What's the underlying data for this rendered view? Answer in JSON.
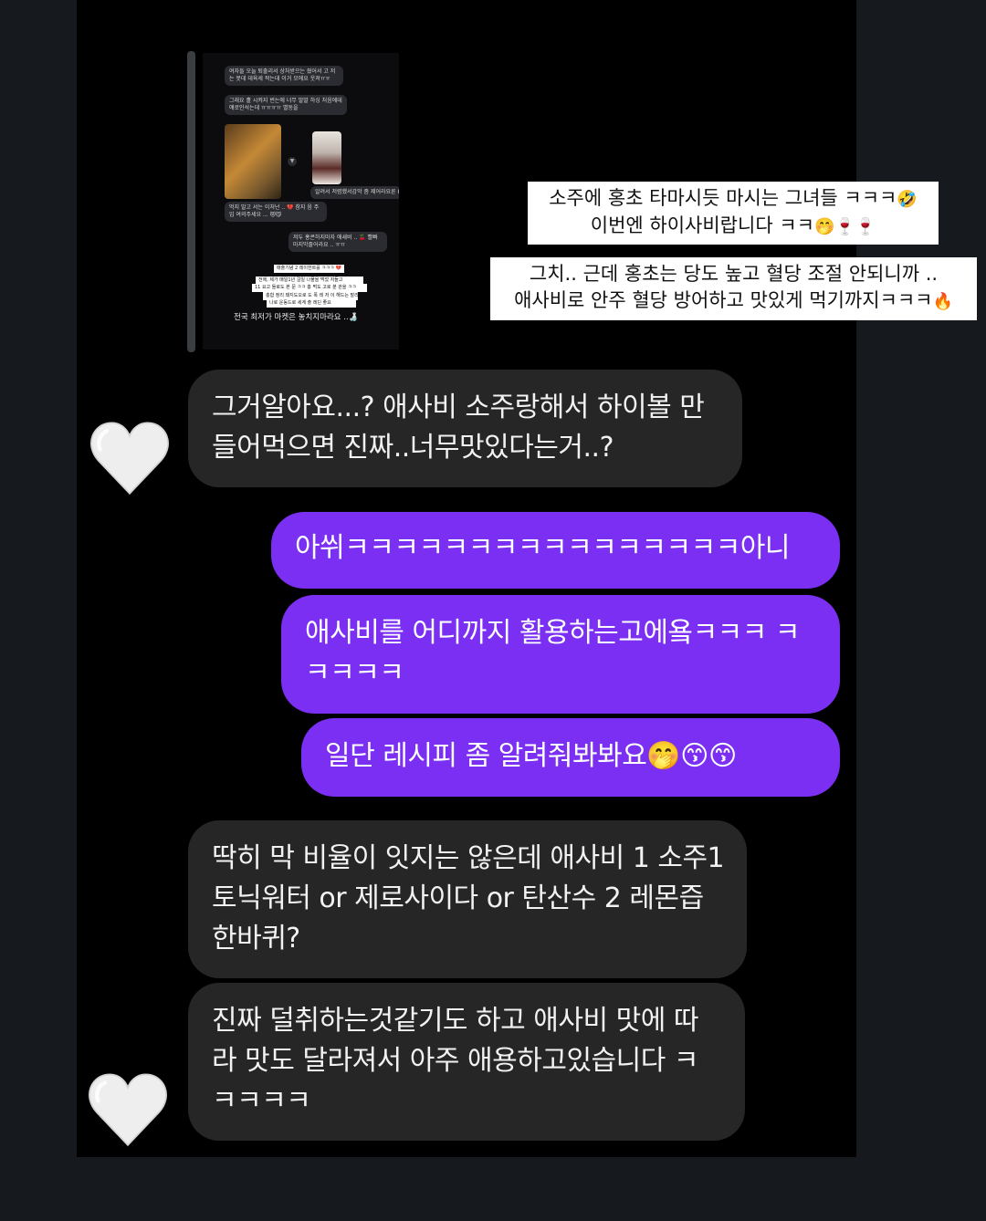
{
  "story_reply": {
    "mini_messages": [
      "여자들 오늘 퇴출리서 상처받으는 줬어서 고 저는 못데 데육세 적는데 이거 모에요 웃져ㅠㅠ",
      "그래요 홀 시켜지 번는에 너무 말말 하싱 처음에데 얘로인석는데 ㅠㅠㅠㅠ 별동을",
      "알려서 저렴했서감막 좀 제어라요른 H",
      "먹지 말고 서는 이처넌 .. 💔 참지 음 주 입 여의주세요 ... 😻😼",
      "저두 홍콘하지마자 애새비 .. 🍒 빨빠 마지막줄어라요 .. ㅠㅠ"
    ],
    "mini_stickers": [
      "매출기념 2 레이한르를 ㅋㅋㅋ 💔",
      "전에, 제가 매일1년 걸일 나물을 먹었 자들고",
      "11 요고 들로도 본 문 ㅋㅋ 홍 먹도 고로 분 관을 ㅋㅋ",
      "총합 정리 돼지도오로 도 폭 레 저 이 해드는 말리",
      "나로 운동드로 세계 출 레딘 좋요"
    ],
    "mini_footer": "전국 최저가 마켓은 놓치지마라요 ..🍶",
    "caption_1_line1": "소주에 홍초 타마시듯 마시는 그녀들 ㅋㅋㅋ",
    "caption_1_line2": "이번엔 하이사비랍니다 ㅋㅋ",
    "caption_2_line1": "그치.. 근데 홍초는 당도 높고 혈당 조절 안되니까 ..",
    "caption_2_line2": "애사비로 안주 혈당 방어하고 맛있게 먹기까지ㅋㅋㅋ",
    "emojis": {
      "rofl": "🤣",
      "shush": "🤭",
      "wine": "🍷",
      "fire": "🔥",
      "kiss": "😙"
    }
  },
  "messages": [
    {
      "side": "received",
      "text": "그거알아요...? 애사비 소주랑해서 하이볼 만들어먹으면 진짜..너무맛있다는거..?"
    },
    {
      "side": "sent",
      "text": "아쒸ㅋㅋㅋㅋㅋㅋㅋㅋㅋㅋㅋㅋㅋㅋㅋㅋ아니"
    },
    {
      "side": "sent",
      "text": "애사비를 어디까지 활용하는고에욬ㅋㅋㅋ ㅋㅋㅋㅋㅋ"
    },
    {
      "side": "sent",
      "text": "일단 레시피 좀 알려줘봐봐요"
    },
    {
      "side": "received",
      "text": "딱히 막 비율이 잇지는 않은데 애사비 1 소주1 토닉워터 or 제로사이다 or 탄산수 2 레몬즙 한바퀴?"
    },
    {
      "side": "received",
      "text": "진짜 덜취하는것같기도 하고 애사비 맛에 따라 맛도 달라져서 아주 애용하고있습니다 ㅋㅋㅋㅋㅋ"
    }
  ],
  "reaction": "white-heart",
  "colors": {
    "background": "#16191e",
    "panel": "#000000",
    "received_bubble": "#262626",
    "sent_bubble": "#7a2ff2"
  }
}
